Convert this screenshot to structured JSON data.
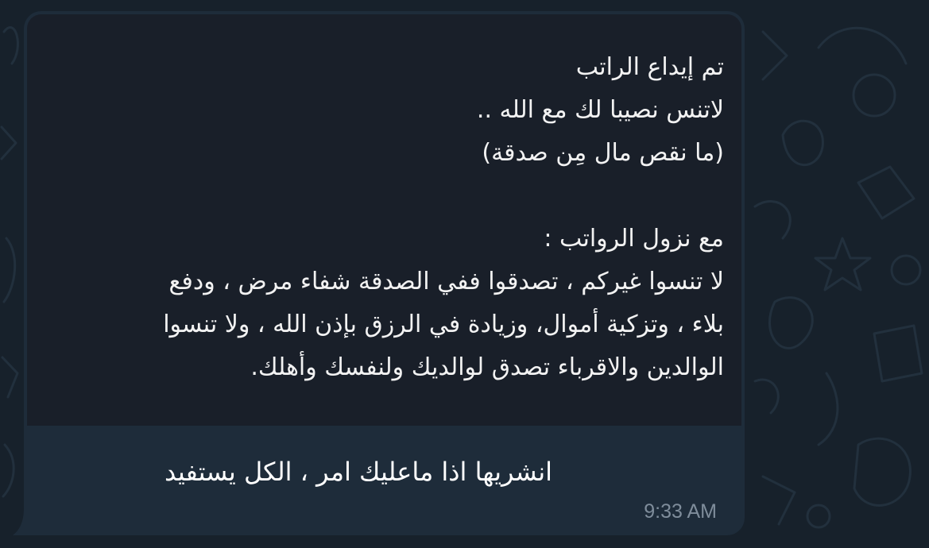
{
  "chat": {
    "background_color": "#17212b",
    "bubble_color": "#1e2c3a"
  },
  "message": {
    "image_text_lines": [
      "تم إيداع  الراتب",
      "لاتنس نصيبا لك مع الله ..",
      "(ما نقص مال مِن صدقة)",
      "",
      "مع نزول  الرواتب :",
      "لا تنسوا غيركم ، تصدقوا ففي الصدقة شفاء مرض ،  ودفع",
      "بلاء ، وتزكية أموال،  وزيادة في الرزق بإذن الله ، ولا تنسوا",
      "الوالدين والاقرباء تصدق لوالديك ولنفسك وأهلك."
    ],
    "caption": "انشريها اذا ماعليك امر ، الكل يستفيد",
    "time": "9:33 AM"
  }
}
